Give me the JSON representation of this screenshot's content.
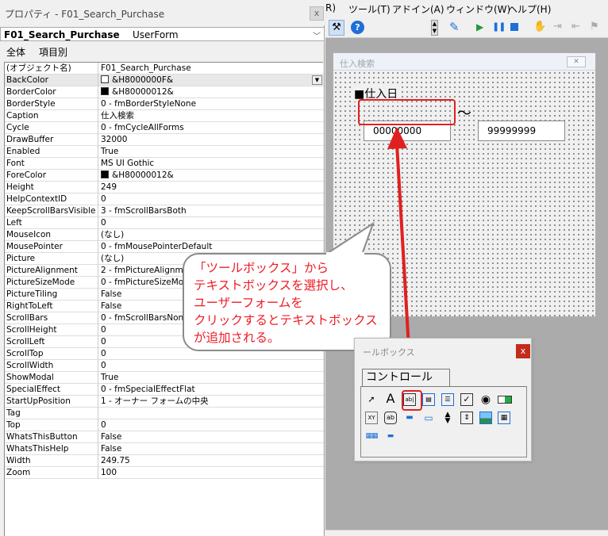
{
  "props_window": {
    "title": "プロパティ - F01_Search_Purchase",
    "close": "x",
    "object_name": "F01_Search_Purchase",
    "object_type": "UserForm",
    "tab_all": "全体",
    "tab_category": "項目別"
  },
  "properties": [
    {
      "name": "(オブジェクト名)",
      "value": "F01_Search_Purchase"
    },
    {
      "name": "BackColor",
      "value": "&H8000000F&",
      "swatch": "#ffffff"
    },
    {
      "name": "BorderColor",
      "value": "&H80000012&",
      "swatch": "#000000"
    },
    {
      "name": "BorderStyle",
      "value": "0 - fmBorderStyleNone"
    },
    {
      "name": "Caption",
      "value": "仕入検索"
    },
    {
      "name": "Cycle",
      "value": "0 - fmCycleAllForms"
    },
    {
      "name": "DrawBuffer",
      "value": "32000"
    },
    {
      "name": "Enabled",
      "value": "True"
    },
    {
      "name": "Font",
      "value": "MS UI Gothic"
    },
    {
      "name": "ForeColor",
      "value": "&H80000012&",
      "swatch": "#000000"
    },
    {
      "name": "Height",
      "value": "249"
    },
    {
      "name": "HelpContextID",
      "value": "0"
    },
    {
      "name": "KeepScrollBarsVisible",
      "value": "3 - fmScrollBarsBoth"
    },
    {
      "name": "Left",
      "value": "0"
    },
    {
      "name": "MouseIcon",
      "value": "(なし)"
    },
    {
      "name": "MousePointer",
      "value": "0 - fmMousePointerDefault"
    },
    {
      "name": "Picture",
      "value": "(なし)"
    },
    {
      "name": "PictureAlignment",
      "value": "2 - fmPictureAlignment"
    },
    {
      "name": "PictureSizeMode",
      "value": "0 - fmPictureSizeMode"
    },
    {
      "name": "PictureTiling",
      "value": "False"
    },
    {
      "name": "RightToLeft",
      "value": "False"
    },
    {
      "name": "ScrollBars",
      "value": "0 - fmScrollBarsNone"
    },
    {
      "name": "ScrollHeight",
      "value": "0"
    },
    {
      "name": "ScrollLeft",
      "value": "0"
    },
    {
      "name": "ScrollTop",
      "value": "0"
    },
    {
      "name": "ScrollWidth",
      "value": "0"
    },
    {
      "name": "ShowModal",
      "value": "True"
    },
    {
      "name": "SpecialEffect",
      "value": "0 - fmSpecialEffectFlat"
    },
    {
      "name": "StartUpPosition",
      "value": "1 - オーナー フォームの中央"
    },
    {
      "name": "Tag",
      "value": ""
    },
    {
      "name": "Top",
      "value": "0"
    },
    {
      "name": "WhatsThisButton",
      "value": "False"
    },
    {
      "name": "WhatsThisHelp",
      "value": "False"
    },
    {
      "name": "Width",
      "value": "249.75"
    },
    {
      "name": "Zoom",
      "value": "100"
    }
  ],
  "menubar": {
    "m0": "R)",
    "m1": "ツール(T)",
    "m2": "アドイン(A)",
    "m3": "ウィンドウ(W)",
    "m4": "ヘルプ(H)"
  },
  "userform": {
    "title": "仕入検索",
    "label_date": "■仕入日",
    "tb_from": "00000000",
    "tilde": "～",
    "tb_to": "99999999"
  },
  "callout": {
    "l1": "「ツールボックス」から",
    "l2": "テキストボックスを選択し、",
    "l3": "ユーザーフォームを",
    "l4": "クリックするとテキストボックス",
    "l5": "が追加される。"
  },
  "toolbox": {
    "title": "ールボックス",
    "close": "x",
    "tab": "コントロール"
  },
  "colors": {
    "accent_red": "#e02020",
    "callout_text": "#ee1c25",
    "close_red": "#c42b1c"
  },
  "icons": [
    "pointer-icon",
    "label-icon",
    "textbox-icon",
    "combobox-icon",
    "listbox-icon",
    "checkbox-icon",
    "optionbutton-icon",
    "togglebutton-icon",
    "frame-icon",
    "commandbutton-icon",
    "tabstrip-icon",
    "multipage-icon",
    "scrollbar-icon",
    "spinbutton-icon",
    "image-icon",
    "refedit-icon",
    "more-icon",
    "ruler-icon"
  ]
}
